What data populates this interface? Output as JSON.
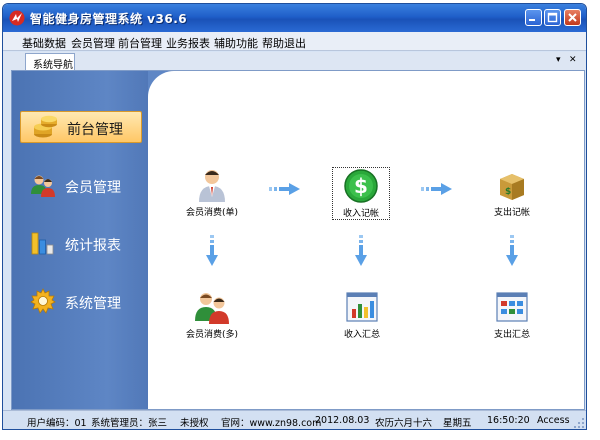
{
  "window": {
    "title": "智能健身房管理系统 v36.6"
  },
  "menu": {
    "items": [
      {
        "label": "基础数据"
      },
      {
        "label": "会员管理"
      },
      {
        "label": "前台管理"
      },
      {
        "label": "业务报表"
      },
      {
        "label": "辅助功能"
      },
      {
        "label": "帮助退出"
      }
    ]
  },
  "tabs": {
    "active_label": "系统导航",
    "dropdown_glyph": "▾",
    "close_glyph": "✕"
  },
  "sidebar": {
    "items": [
      {
        "label": "前台管理",
        "icon": "coins-icon",
        "active": true
      },
      {
        "label": "会员管理",
        "icon": "members-icon",
        "active": false
      },
      {
        "label": "统计报表",
        "icon": "bar-chart-icon",
        "active": false
      },
      {
        "label": "系统管理",
        "icon": "gear-icon",
        "active": false
      }
    ]
  },
  "flow": {
    "nodes": [
      {
        "label": "会员消费(单)",
        "icon": "single-member-icon"
      },
      {
        "label": "收入记帐",
        "icon": "dollar-coin-icon",
        "selected": true
      },
      {
        "label": "支出记帐",
        "icon": "money-box-icon"
      },
      {
        "label": "会员消费(多)",
        "icon": "group-members-icon"
      },
      {
        "label": "收入汇总",
        "icon": "income-chart-icon"
      },
      {
        "label": "支出汇总",
        "icon": "expense-grid-icon"
      }
    ]
  },
  "status": {
    "user_code": "用户编码：01",
    "admin": "系统管理员：张三",
    "license": "未授权",
    "website": "官网：www.zn98.com",
    "date": "2012.08.03",
    "lunar": "农历六月十六",
    "weekday": "星期五",
    "time": "16:50:20",
    "db": "Access"
  },
  "colors": {
    "titlebar": "#1f5fc9",
    "sidebar": "#5e86c5",
    "active_item": "#ffc766",
    "flow_arrow": "#5aa0e6"
  }
}
